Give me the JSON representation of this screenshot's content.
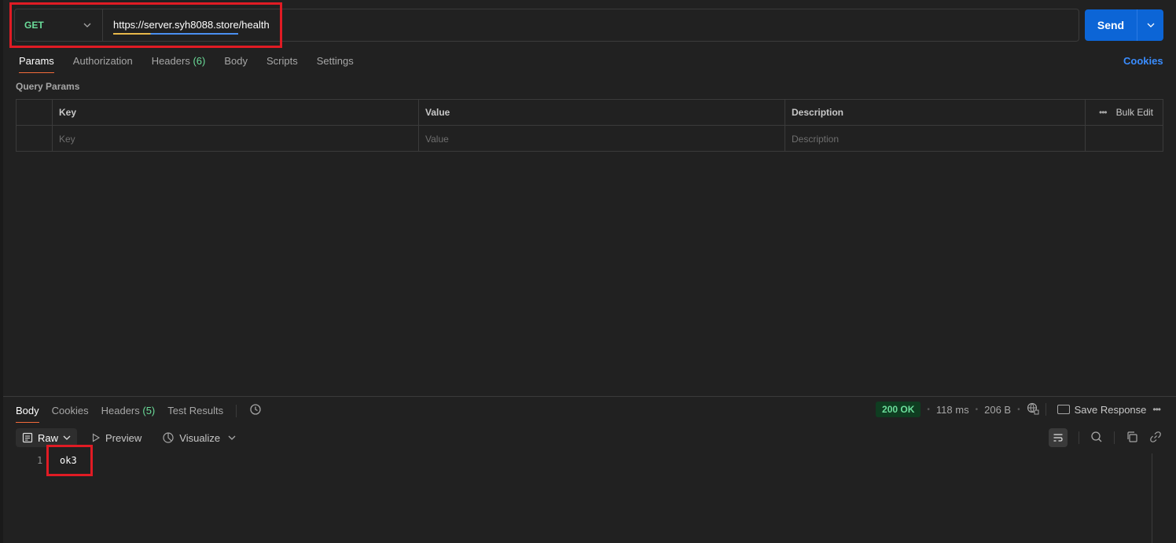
{
  "request": {
    "method": "GET",
    "url": "https://server.syh8088.store/health",
    "send_label": "Send"
  },
  "request_tabs": [
    {
      "label": "Params",
      "active": true
    },
    {
      "label": "Authorization"
    },
    {
      "label": "Headers",
      "count": "(6)"
    },
    {
      "label": "Body"
    },
    {
      "label": "Scripts"
    },
    {
      "label": "Settings"
    }
  ],
  "cookies_label": "Cookies",
  "query_params": {
    "title": "Query Params",
    "columns": [
      "Key",
      "Value",
      "Description"
    ],
    "bulk_edit": "Bulk Edit",
    "placeholders": {
      "key": "Key",
      "value": "Value",
      "description": "Description"
    }
  },
  "response_tabs": [
    {
      "label": "Body",
      "active": true
    },
    {
      "label": "Cookies"
    },
    {
      "label": "Headers",
      "count": "(5)"
    },
    {
      "label": "Test Results"
    }
  ],
  "response_meta": {
    "status": "200 OK",
    "time": "118 ms",
    "size": "206 B",
    "save_label": "Save Response"
  },
  "response_toolbar": {
    "format": "Raw",
    "preview": "Preview",
    "visualize": "Visualize"
  },
  "response_body": {
    "line_number": "1",
    "content": "ok3"
  },
  "colors": {
    "background": "#212121",
    "send_blue": "#0c65d6",
    "get_green": "#6bdd9a",
    "active_tab_underline": "#f26b3a",
    "highlight_red": "#e01b24"
  }
}
